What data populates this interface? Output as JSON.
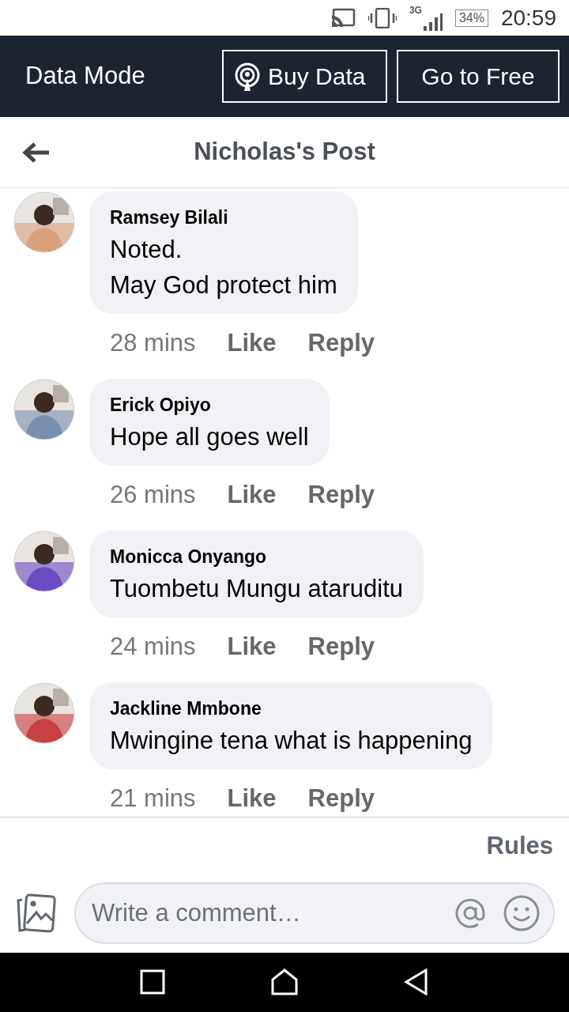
{
  "status_bar": {
    "network": "3G",
    "battery": "34%",
    "time": "20:59"
  },
  "data_mode_bar": {
    "title": "Data Mode",
    "buttons": [
      "Buy Data",
      "Go to Free"
    ]
  },
  "header": {
    "title": "Nicholas's Post"
  },
  "comments": [
    {
      "author": "Ramsey Bilali",
      "lines": [
        "Noted.",
        "May God protect him"
      ],
      "time": "28 mins",
      "actions": [
        "Like",
        "Reply"
      ]
    },
    {
      "author": "Erick Opiyo",
      "lines": [
        "Hope all goes well"
      ],
      "time": "26 mins",
      "actions": [
        "Like",
        "Reply"
      ]
    },
    {
      "author": "Monicca Onyango",
      "lines": [
        "Tuombetu Mungu ataruditu"
      ],
      "time": "24 mins",
      "actions": [
        "Like",
        "Reply"
      ]
    },
    {
      "author": "Jackline Mmbone",
      "lines": [
        "Mwingine tena what is happening"
      ],
      "time": "21 mins",
      "actions": [
        "Like",
        "Reply"
      ]
    }
  ],
  "rules_link": "Rules",
  "composer": {
    "placeholder": "Write a comment…"
  }
}
